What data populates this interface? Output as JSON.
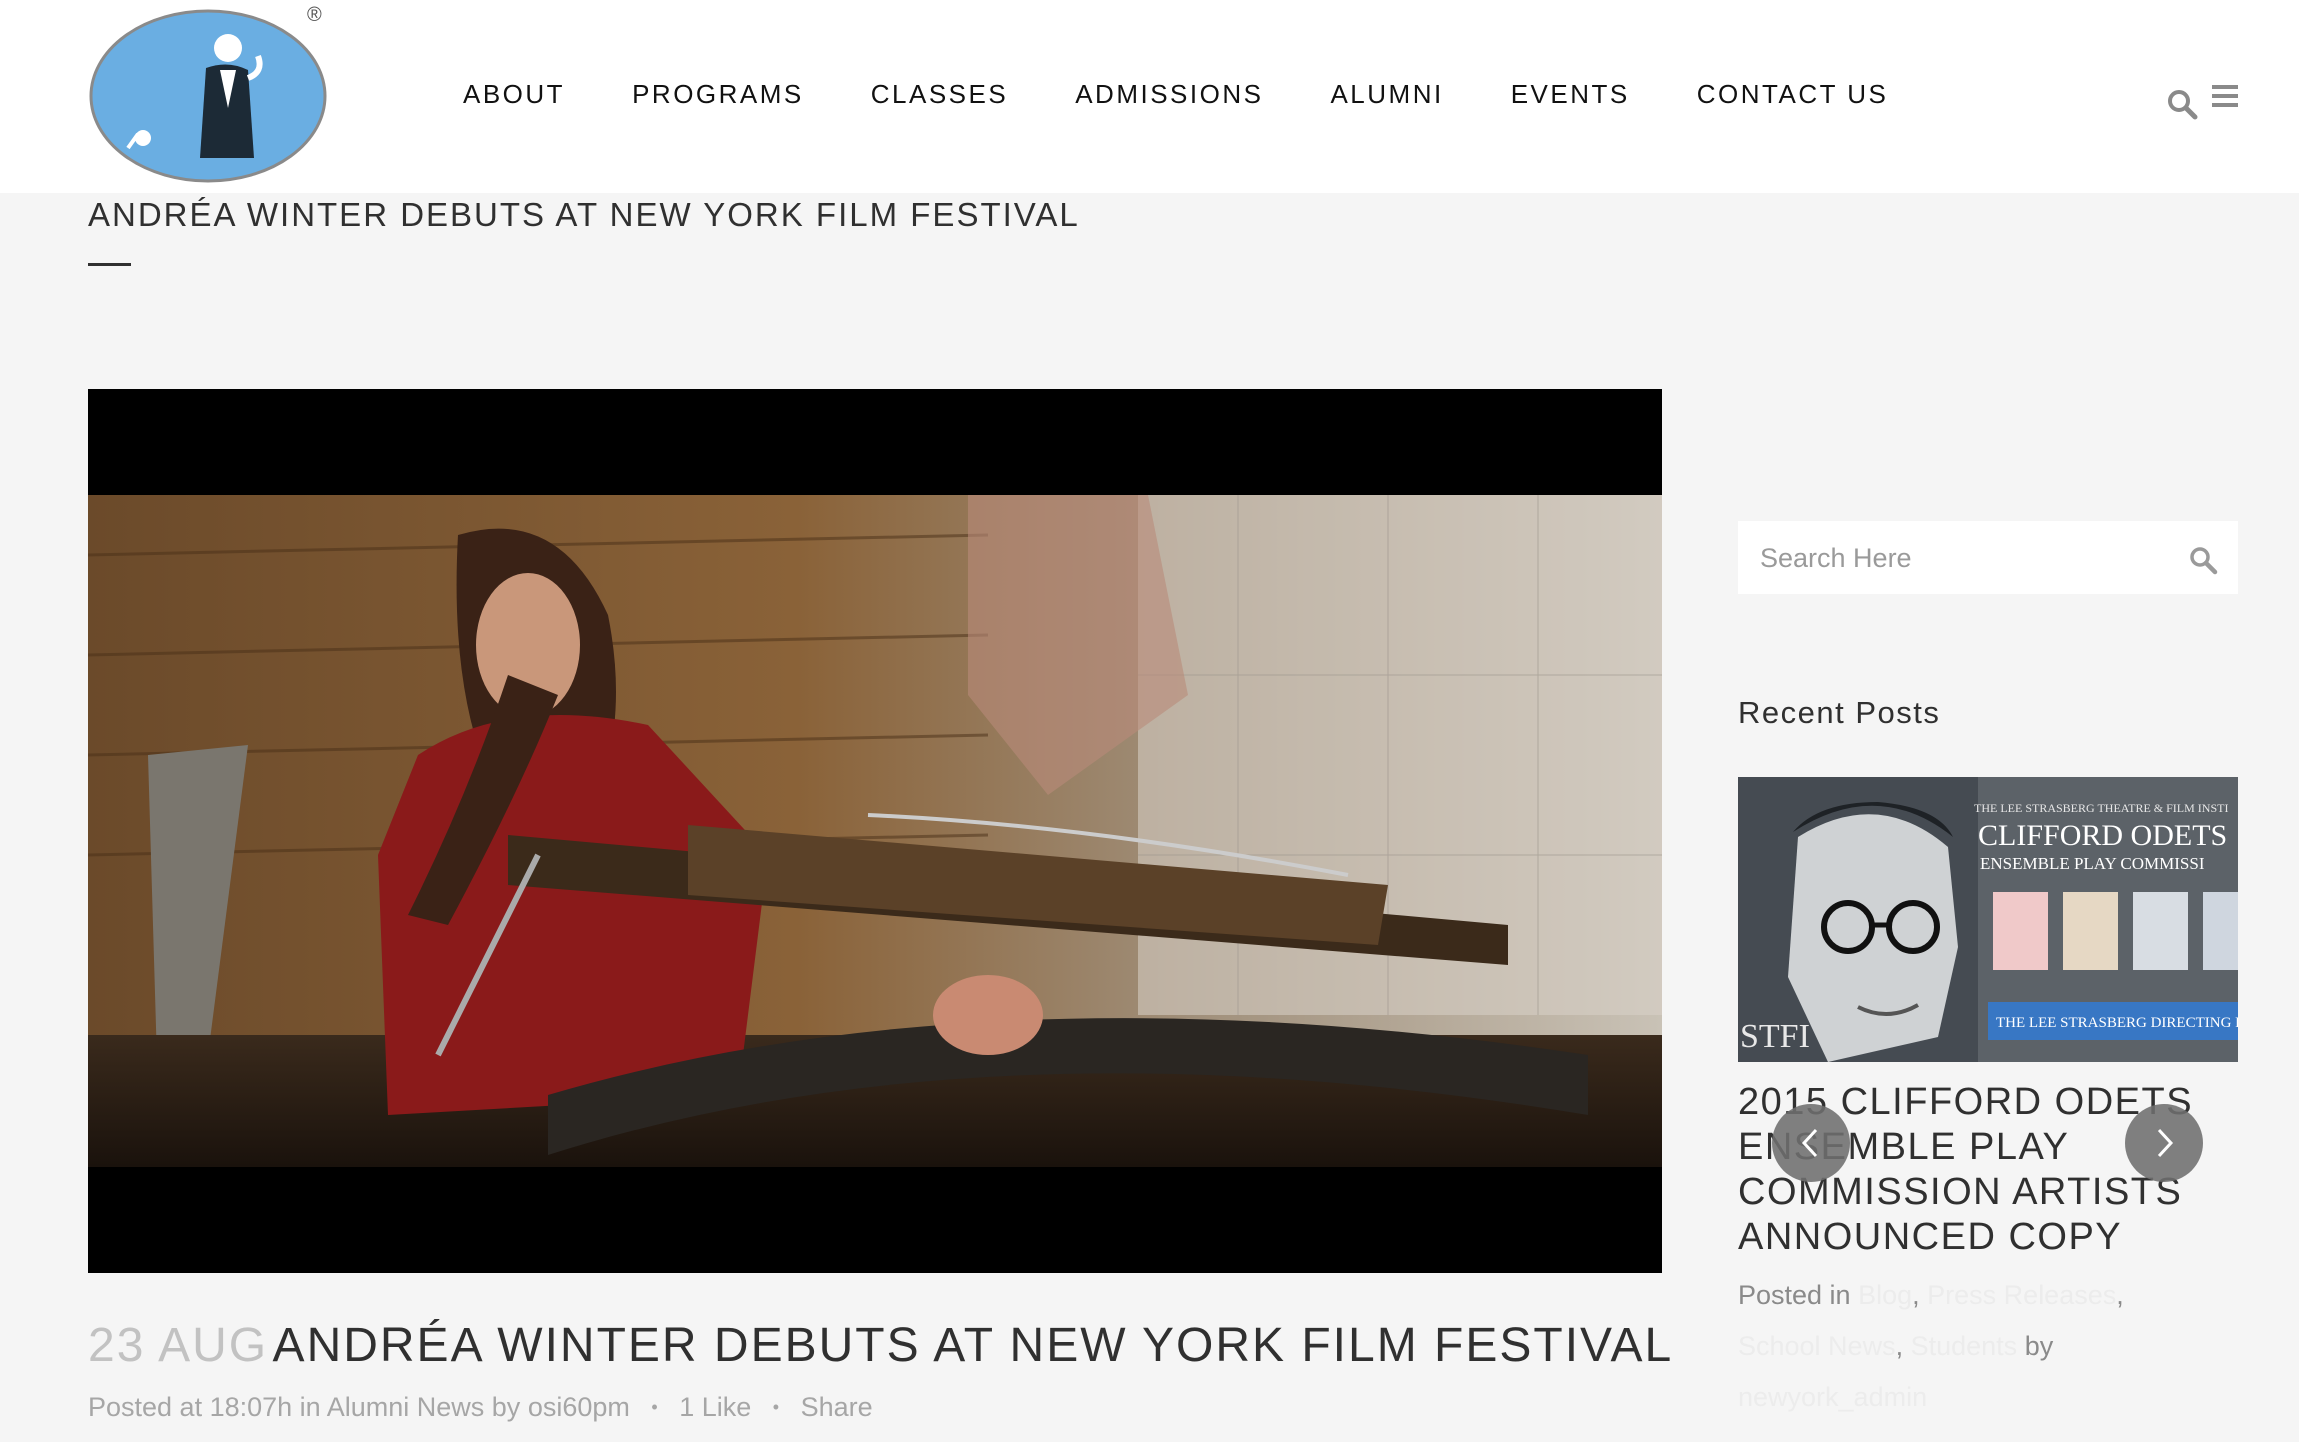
{
  "header": {
    "registered_mark": "®",
    "nav": [
      "ABOUT",
      "PROGRAMS",
      "CLASSES",
      "ADMISSIONS",
      "ALUMNI",
      "EVENTS",
      "CONTACT US"
    ]
  },
  "page": {
    "title": "ANDRÉA WINTER DEBUTS AT NEW YORK FILM FESTIVAL"
  },
  "post": {
    "date": "23 AUG",
    "title": "ANDRÉA WINTER DEBUTS AT NEW YORK FILM FESTIVAL",
    "posted_at": "Posted at 18:07h in",
    "category": "Alumni News",
    "by": "by",
    "author": "osi60pm",
    "likes": "1 Like",
    "share": "Share"
  },
  "sidebar": {
    "search_placeholder": "Search Here",
    "recent_title": "Recent Posts",
    "recent_post": {
      "image_heading": "CLIFFORD ODETS",
      "image_subheading": "ENSEMBLE PLAY COMMISSI",
      "image_top": "THE LEE STRASBERG THEATRE & FILM INSTI",
      "image_banner": "THE LEE STRASBERG DIRECTING FELLOWS",
      "image_logo": "STFI",
      "title": "2015 CLIFFORD ODETS ENSEMBLE PLAY COMMISSION ARTISTS ANNOUNCED COPY",
      "posted_in": "Posted in",
      "categories": [
        "Blog",
        "Press Releases",
        "School News",
        "Students"
      ],
      "by": "by",
      "author": "newyork_admin"
    }
  },
  "colors": {
    "logo_blue": "#6aaee2",
    "header_bg": "#ffffff",
    "page_bg": "#f5f5f5",
    "text_dark": "#303030",
    "meta_gray": "#a6a6a6"
  }
}
